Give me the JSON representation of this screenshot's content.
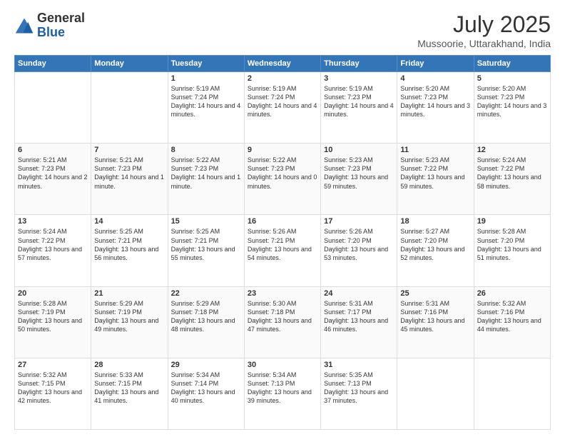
{
  "logo": {
    "general": "General",
    "blue": "Blue"
  },
  "header": {
    "month": "July 2025",
    "location": "Mussoorie, Uttarakhand, India"
  },
  "days_of_week": [
    "Sunday",
    "Monday",
    "Tuesday",
    "Wednesday",
    "Thursday",
    "Friday",
    "Saturday"
  ],
  "weeks": [
    [
      {
        "day": "",
        "info": ""
      },
      {
        "day": "",
        "info": ""
      },
      {
        "day": "1",
        "info": "Sunrise: 5:19 AM\nSunset: 7:24 PM\nDaylight: 14 hours and 4 minutes."
      },
      {
        "day": "2",
        "info": "Sunrise: 5:19 AM\nSunset: 7:24 PM\nDaylight: 14 hours and 4 minutes."
      },
      {
        "day": "3",
        "info": "Sunrise: 5:19 AM\nSunset: 7:23 PM\nDaylight: 14 hours and 4 minutes."
      },
      {
        "day": "4",
        "info": "Sunrise: 5:20 AM\nSunset: 7:23 PM\nDaylight: 14 hours and 3 minutes."
      },
      {
        "day": "5",
        "info": "Sunrise: 5:20 AM\nSunset: 7:23 PM\nDaylight: 14 hours and 3 minutes."
      }
    ],
    [
      {
        "day": "6",
        "info": "Sunrise: 5:21 AM\nSunset: 7:23 PM\nDaylight: 14 hours and 2 minutes."
      },
      {
        "day": "7",
        "info": "Sunrise: 5:21 AM\nSunset: 7:23 PM\nDaylight: 14 hours and 1 minute."
      },
      {
        "day": "8",
        "info": "Sunrise: 5:22 AM\nSunset: 7:23 PM\nDaylight: 14 hours and 1 minute."
      },
      {
        "day": "9",
        "info": "Sunrise: 5:22 AM\nSunset: 7:23 PM\nDaylight: 14 hours and 0 minutes."
      },
      {
        "day": "10",
        "info": "Sunrise: 5:23 AM\nSunset: 7:23 PM\nDaylight: 13 hours and 59 minutes."
      },
      {
        "day": "11",
        "info": "Sunrise: 5:23 AM\nSunset: 7:22 PM\nDaylight: 13 hours and 59 minutes."
      },
      {
        "day": "12",
        "info": "Sunrise: 5:24 AM\nSunset: 7:22 PM\nDaylight: 13 hours and 58 minutes."
      }
    ],
    [
      {
        "day": "13",
        "info": "Sunrise: 5:24 AM\nSunset: 7:22 PM\nDaylight: 13 hours and 57 minutes."
      },
      {
        "day": "14",
        "info": "Sunrise: 5:25 AM\nSunset: 7:21 PM\nDaylight: 13 hours and 56 minutes."
      },
      {
        "day": "15",
        "info": "Sunrise: 5:25 AM\nSunset: 7:21 PM\nDaylight: 13 hours and 55 minutes."
      },
      {
        "day": "16",
        "info": "Sunrise: 5:26 AM\nSunset: 7:21 PM\nDaylight: 13 hours and 54 minutes."
      },
      {
        "day": "17",
        "info": "Sunrise: 5:26 AM\nSunset: 7:20 PM\nDaylight: 13 hours and 53 minutes."
      },
      {
        "day": "18",
        "info": "Sunrise: 5:27 AM\nSunset: 7:20 PM\nDaylight: 13 hours and 52 minutes."
      },
      {
        "day": "19",
        "info": "Sunrise: 5:28 AM\nSunset: 7:20 PM\nDaylight: 13 hours and 51 minutes."
      }
    ],
    [
      {
        "day": "20",
        "info": "Sunrise: 5:28 AM\nSunset: 7:19 PM\nDaylight: 13 hours and 50 minutes."
      },
      {
        "day": "21",
        "info": "Sunrise: 5:29 AM\nSunset: 7:19 PM\nDaylight: 13 hours and 49 minutes."
      },
      {
        "day": "22",
        "info": "Sunrise: 5:29 AM\nSunset: 7:18 PM\nDaylight: 13 hours and 48 minutes."
      },
      {
        "day": "23",
        "info": "Sunrise: 5:30 AM\nSunset: 7:18 PM\nDaylight: 13 hours and 47 minutes."
      },
      {
        "day": "24",
        "info": "Sunrise: 5:31 AM\nSunset: 7:17 PM\nDaylight: 13 hours and 46 minutes."
      },
      {
        "day": "25",
        "info": "Sunrise: 5:31 AM\nSunset: 7:16 PM\nDaylight: 13 hours and 45 minutes."
      },
      {
        "day": "26",
        "info": "Sunrise: 5:32 AM\nSunset: 7:16 PM\nDaylight: 13 hours and 44 minutes."
      }
    ],
    [
      {
        "day": "27",
        "info": "Sunrise: 5:32 AM\nSunset: 7:15 PM\nDaylight: 13 hours and 42 minutes."
      },
      {
        "day": "28",
        "info": "Sunrise: 5:33 AM\nSunset: 7:15 PM\nDaylight: 13 hours and 41 minutes."
      },
      {
        "day": "29",
        "info": "Sunrise: 5:34 AM\nSunset: 7:14 PM\nDaylight: 13 hours and 40 minutes."
      },
      {
        "day": "30",
        "info": "Sunrise: 5:34 AM\nSunset: 7:13 PM\nDaylight: 13 hours and 39 minutes."
      },
      {
        "day": "31",
        "info": "Sunrise: 5:35 AM\nSunset: 7:13 PM\nDaylight: 13 hours and 37 minutes."
      },
      {
        "day": "",
        "info": ""
      },
      {
        "day": "",
        "info": ""
      }
    ]
  ]
}
